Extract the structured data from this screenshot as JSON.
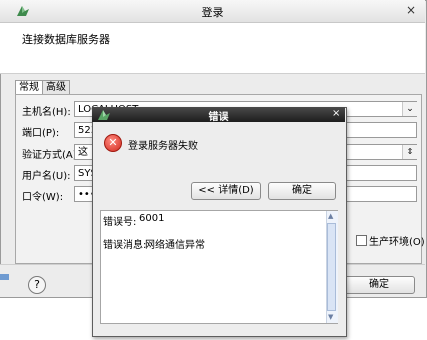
{
  "main_window": {
    "title": "登录",
    "close_glyph": "×",
    "header": "连接数据库服务器",
    "tabs": [
      "常规",
      "高级"
    ],
    "fields": [
      {
        "label": "主机名(H):",
        "value": "LOCALHOST"
      },
      {
        "label": "端口(P):",
        "value": "523"
      },
      {
        "label": "验证方式(A):",
        "value": "这"
      },
      {
        "label": "用户名(U):",
        "value": "SYS"
      },
      {
        "label": "口令(W):",
        "value": "•••"
      }
    ],
    "checkbox_partial": ")",
    "production_checkbox": {
      "label": "生产环境(O)",
      "checked": false
    },
    "help_glyph": "?",
    "ok_button": "确定"
  },
  "error_dialog": {
    "title": "错误",
    "close_glyph": "×",
    "icon": "error-x-icon",
    "message": "登录服务器失败",
    "details_button": "<< 详情(D)",
    "ok_button": "确定",
    "details": {
      "error_code_label": "错误号:",
      "error_code": "6001",
      "error_message_label": "错误消息:",
      "error_message": "网络通信异常"
    }
  }
}
